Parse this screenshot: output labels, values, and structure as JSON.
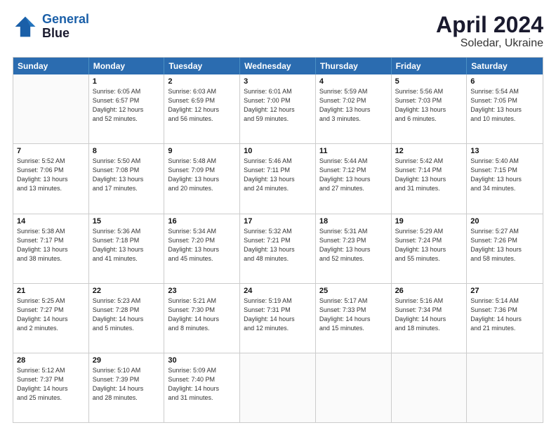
{
  "header": {
    "logo_line1": "General",
    "logo_line2": "Blue",
    "title": "April 2024",
    "subtitle": "Soledar, Ukraine"
  },
  "weekdays": [
    "Sunday",
    "Monday",
    "Tuesday",
    "Wednesday",
    "Thursday",
    "Friday",
    "Saturday"
  ],
  "rows": [
    [
      {
        "day": "",
        "info": ""
      },
      {
        "day": "1",
        "info": "Sunrise: 6:05 AM\nSunset: 6:57 PM\nDaylight: 12 hours\nand 52 minutes."
      },
      {
        "day": "2",
        "info": "Sunrise: 6:03 AM\nSunset: 6:59 PM\nDaylight: 12 hours\nand 56 minutes."
      },
      {
        "day": "3",
        "info": "Sunrise: 6:01 AM\nSunset: 7:00 PM\nDaylight: 12 hours\nand 59 minutes."
      },
      {
        "day": "4",
        "info": "Sunrise: 5:59 AM\nSunset: 7:02 PM\nDaylight: 13 hours\nand 3 minutes."
      },
      {
        "day": "5",
        "info": "Sunrise: 5:56 AM\nSunset: 7:03 PM\nDaylight: 13 hours\nand 6 minutes."
      },
      {
        "day": "6",
        "info": "Sunrise: 5:54 AM\nSunset: 7:05 PM\nDaylight: 13 hours\nand 10 minutes."
      }
    ],
    [
      {
        "day": "7",
        "info": "Sunrise: 5:52 AM\nSunset: 7:06 PM\nDaylight: 13 hours\nand 13 minutes."
      },
      {
        "day": "8",
        "info": "Sunrise: 5:50 AM\nSunset: 7:08 PM\nDaylight: 13 hours\nand 17 minutes."
      },
      {
        "day": "9",
        "info": "Sunrise: 5:48 AM\nSunset: 7:09 PM\nDaylight: 13 hours\nand 20 minutes."
      },
      {
        "day": "10",
        "info": "Sunrise: 5:46 AM\nSunset: 7:11 PM\nDaylight: 13 hours\nand 24 minutes."
      },
      {
        "day": "11",
        "info": "Sunrise: 5:44 AM\nSunset: 7:12 PM\nDaylight: 13 hours\nand 27 minutes."
      },
      {
        "day": "12",
        "info": "Sunrise: 5:42 AM\nSunset: 7:14 PM\nDaylight: 13 hours\nand 31 minutes."
      },
      {
        "day": "13",
        "info": "Sunrise: 5:40 AM\nSunset: 7:15 PM\nDaylight: 13 hours\nand 34 minutes."
      }
    ],
    [
      {
        "day": "14",
        "info": "Sunrise: 5:38 AM\nSunset: 7:17 PM\nDaylight: 13 hours\nand 38 minutes."
      },
      {
        "day": "15",
        "info": "Sunrise: 5:36 AM\nSunset: 7:18 PM\nDaylight: 13 hours\nand 41 minutes."
      },
      {
        "day": "16",
        "info": "Sunrise: 5:34 AM\nSunset: 7:20 PM\nDaylight: 13 hours\nand 45 minutes."
      },
      {
        "day": "17",
        "info": "Sunrise: 5:32 AM\nSunset: 7:21 PM\nDaylight: 13 hours\nand 48 minutes."
      },
      {
        "day": "18",
        "info": "Sunrise: 5:31 AM\nSunset: 7:23 PM\nDaylight: 13 hours\nand 52 minutes."
      },
      {
        "day": "19",
        "info": "Sunrise: 5:29 AM\nSunset: 7:24 PM\nDaylight: 13 hours\nand 55 minutes."
      },
      {
        "day": "20",
        "info": "Sunrise: 5:27 AM\nSunset: 7:26 PM\nDaylight: 13 hours\nand 58 minutes."
      }
    ],
    [
      {
        "day": "21",
        "info": "Sunrise: 5:25 AM\nSunset: 7:27 PM\nDaylight: 14 hours\nand 2 minutes."
      },
      {
        "day": "22",
        "info": "Sunrise: 5:23 AM\nSunset: 7:28 PM\nDaylight: 14 hours\nand 5 minutes."
      },
      {
        "day": "23",
        "info": "Sunrise: 5:21 AM\nSunset: 7:30 PM\nDaylight: 14 hours\nand 8 minutes."
      },
      {
        "day": "24",
        "info": "Sunrise: 5:19 AM\nSunset: 7:31 PM\nDaylight: 14 hours\nand 12 minutes."
      },
      {
        "day": "25",
        "info": "Sunrise: 5:17 AM\nSunset: 7:33 PM\nDaylight: 14 hours\nand 15 minutes."
      },
      {
        "day": "26",
        "info": "Sunrise: 5:16 AM\nSunset: 7:34 PM\nDaylight: 14 hours\nand 18 minutes."
      },
      {
        "day": "27",
        "info": "Sunrise: 5:14 AM\nSunset: 7:36 PM\nDaylight: 14 hours\nand 21 minutes."
      }
    ],
    [
      {
        "day": "28",
        "info": "Sunrise: 5:12 AM\nSunset: 7:37 PM\nDaylight: 14 hours\nand 25 minutes."
      },
      {
        "day": "29",
        "info": "Sunrise: 5:10 AM\nSunset: 7:39 PM\nDaylight: 14 hours\nand 28 minutes."
      },
      {
        "day": "30",
        "info": "Sunrise: 5:09 AM\nSunset: 7:40 PM\nDaylight: 14 hours\nand 31 minutes."
      },
      {
        "day": "",
        "info": ""
      },
      {
        "day": "",
        "info": ""
      },
      {
        "day": "",
        "info": ""
      },
      {
        "day": "",
        "info": ""
      }
    ]
  ]
}
